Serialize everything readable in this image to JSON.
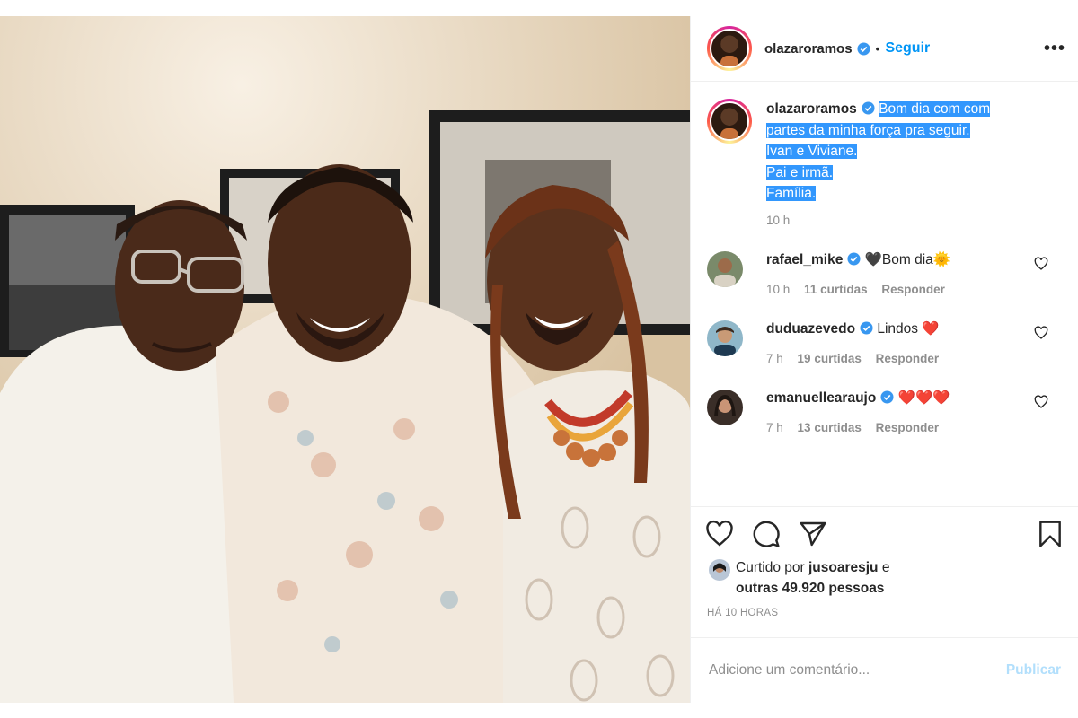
{
  "post": {
    "username": "olazaroramos",
    "follow_label": "Seguir",
    "separator": "•",
    "more_label": "•••",
    "caption": {
      "line1": "Bom dia com com",
      "line2": "partes da minha força pra seguir.",
      "line3": "Ivan e Viviane.",
      "line4": "Pai e irmã.",
      "line5": "Família."
    },
    "caption_time": "10 h",
    "comments": [
      {
        "username": "rafael_mike",
        "text": "🖤Bom dia🌞",
        "time": "10 h",
        "likes": "11 curtidas",
        "reply": "Responder"
      },
      {
        "username": "duduazevedo",
        "text": "Lindos ❤️",
        "time": "7 h",
        "likes": "19 curtidas",
        "reply": "Responder"
      },
      {
        "username": "emanuellearaujo",
        "text": "❤️❤️❤️",
        "time": "7 h",
        "likes": "13 curtidas",
        "reply": "Responder"
      }
    ],
    "liked_by_prefix": "Curtido por",
    "liked_by_user": "jusoaresju",
    "liked_by_and": "e",
    "liked_by_others": "outras 49.920 pessoas",
    "posted_ago": "HÁ 10 HORAS",
    "comment_placeholder": "Adicione um comentário...",
    "publish_label": "Publicar"
  },
  "icons": [
    "verified-badge-icon",
    "heart-icon",
    "comment-icon",
    "share-icon",
    "bookmark-icon",
    "more-options-icon"
  ],
  "colors": {
    "link_blue": "#0095f6",
    "selection_blue": "#3297fd",
    "muted": "#8e8e8e",
    "verified": "#3897f0",
    "heart_red": "#ed4956"
  }
}
